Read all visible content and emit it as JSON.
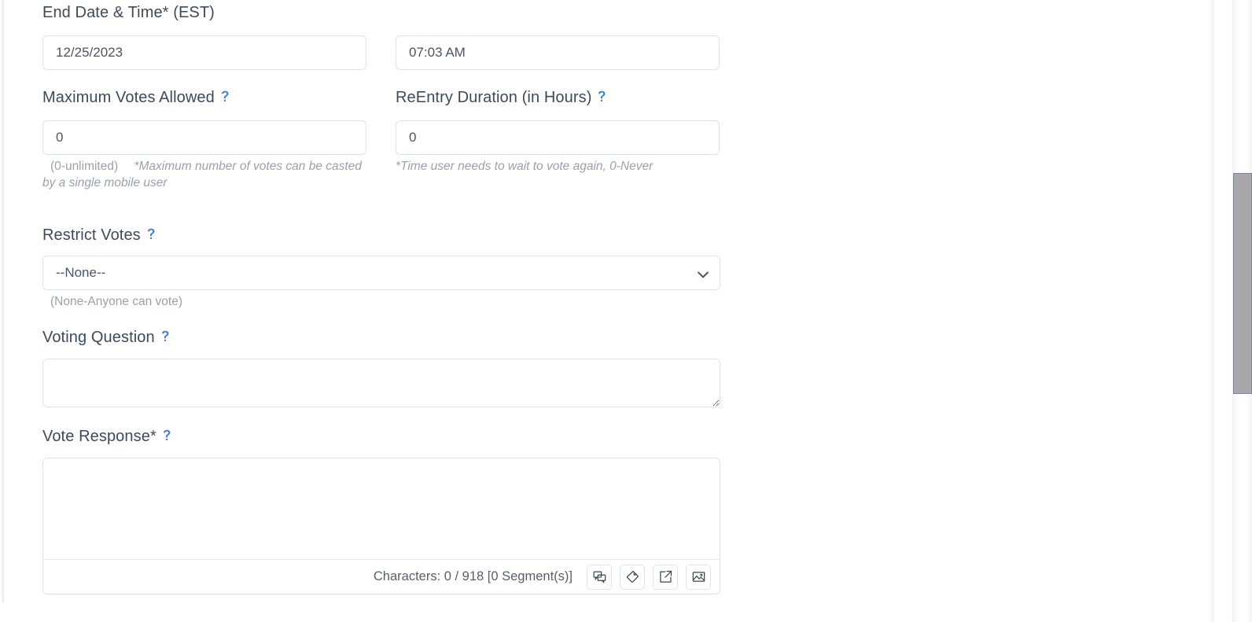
{
  "form": {
    "end_datetime": {
      "label": "End Date & Time* (EST)",
      "date_value": "12/25/2023",
      "time_value": "07:03 AM"
    },
    "max_votes": {
      "label": "Maximum Votes Allowed",
      "value": "0",
      "help_icon": "question-help-icon",
      "helper_plain": "(0-unlimited)",
      "helper_italic": "*Maximum number of votes can be casted by a single mobile user"
    },
    "reentry_duration": {
      "label": "ReEntry Duration (in Hours)",
      "value": "0",
      "help_icon": "question-help-icon",
      "helper_italic": "*Time user needs to wait to vote again, 0-Never"
    },
    "restrict_votes": {
      "label": "Restrict Votes",
      "selected": "--None--",
      "options": [
        "--None--"
      ],
      "helper_plain": "(None-Anyone can vote)"
    },
    "voting_question": {
      "label": "Voting Question",
      "value": "",
      "placeholder": ""
    },
    "vote_response": {
      "label": "Vote Response*",
      "value": "",
      "placeholder": "",
      "char_counter": "Characters: 0 / 918 [0 Segment(s)]",
      "toolbar": [
        {
          "name": "merge-field-icon",
          "title": "Insert Merge Field"
        },
        {
          "name": "tag-icon",
          "title": "Insert Tag"
        },
        {
          "name": "external-link-icon",
          "title": "Insert Link"
        },
        {
          "name": "image-icon",
          "title": "Insert Image"
        }
      ]
    }
  },
  "colors": {
    "label_text": "#3d4a5c",
    "input_text": "#4a5568",
    "helper_text": "#9aa1ab",
    "border": "#dfe3e8",
    "help_icon_blue": "#3b7ddd",
    "scrollbar_thumb": "#a8a8a8"
  }
}
